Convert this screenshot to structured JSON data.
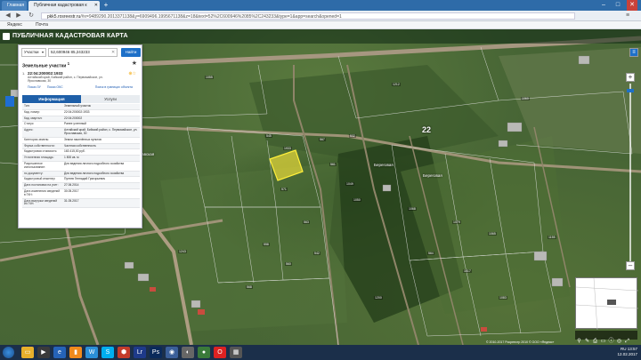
{
  "browser": {
    "tabs": [
      {
        "label": "Главная"
      },
      {
        "label": "Публичная кадастровая к"
      }
    ],
    "url_host": "pkk5.rosreestr.ru",
    "url_rest": "/#x=9489290.2013371138&y=6909496.1995671138&z=18&text=52%2C600946%2085%2C243233&type=1&app=search&opened=1",
    "bookmarks": [
      "Яндекс",
      "Почта"
    ]
  },
  "map_header": {
    "title": "ПУБЛИЧНАЯ КАДАСТРОВАЯ КАРТА"
  },
  "panel": {
    "selector": "Участки",
    "search_value": "52,600946 85,243233",
    "find_label": "Найти",
    "section_title": "Земельные участки",
    "section_count": "1",
    "result_index": "1.",
    "parcel_number": "22:04:200002:1933",
    "parcel_address": "Алтайский край, Бийский район, с. Первомайское, ул. Ярославская, 30",
    "link_zoom": "Показ ЗУ",
    "link_oks": "Показ ОКС",
    "link_border": "Поиск в границах объекта",
    "tab_info": "Информация",
    "tab_services": "Услуги",
    "rows": [
      {
        "k": "Тип:",
        "v": "Земельный участок"
      },
      {
        "k": "Кад. номер:",
        "v": "22:04:200002:1933"
      },
      {
        "k": "Кад. квартал:",
        "v": "22:04:200002"
      },
      {
        "k": "Статус:",
        "v": "Ранее учтенный"
      },
      {
        "k": "Адрес:",
        "v": "Алтайский край, Бийский район, с. Первомайское, ул. Ярославская, 30"
      },
      {
        "k": "Категория земель:",
        "v": "Земли населённых пунктов"
      },
      {
        "k": "Форма собственности:",
        "v": "Частная собственность"
      },
      {
        "k": "Кадастровая стоимость:",
        "v": "163 415,00 руб."
      },
      {
        "k": "Уточненная площадь:",
        "v": "1 800 кв. м"
      },
      {
        "k": "Разрешенное использование:",
        "v": "Для ведения личного подсобного хозяйства"
      },
      {
        "k": "по документу:",
        "v": "Для ведения личного подсобного хозяйства"
      },
      {
        "k": "Кадастровый инженер:",
        "v": "Путеев Геннадий Григорьевич"
      },
      {
        "k": "Дата постановки на учет:",
        "v": "27.06.2014"
      },
      {
        "k": "Дата изменения сведений в ГКН:",
        "v": "30.05.2017"
      },
      {
        "k": "Дата выгрузки сведений из ГКН:",
        "v": "31.05.2017"
      }
    ]
  },
  "map": {
    "block_number": "22",
    "street_labels": [
      "Ярославская",
      "Береговая",
      "Береговая"
    ],
    "parcel_labels": [
      "1933",
      "567",
      "545",
      "561",
      "571",
      "1049",
      "1050",
      "563",
      "558",
      "560",
      "542",
      "1068",
      "1079",
      "1065",
      "564",
      "1017",
      "1083",
      "568",
      "532",
      "1055",
      "1212",
      "1060",
      "1221",
      "1155",
      "1243",
      "1200"
    ],
    "highlight_color": "#f5e43a",
    "copyright": "© 2010-2017 Росреестр 2010 © ООО «Яндекс»"
  },
  "taskbar": {
    "time": "13:57",
    "date": "12.02.2017",
    "lang": "RU"
  }
}
